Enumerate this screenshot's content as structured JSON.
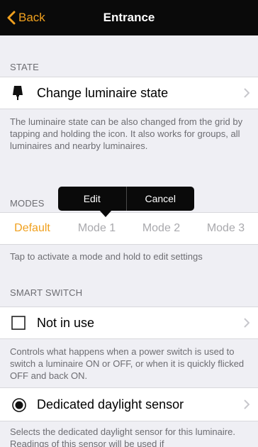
{
  "nav": {
    "back_label": "Back",
    "title": "Entrance"
  },
  "state": {
    "header": "STATE",
    "cell_label": "Change luminaire state",
    "footer": "The luminaire state can be also changed from the grid by tapping and holding the icon. It also works for groups, all luminaires and nearby luminaires."
  },
  "modes": {
    "header": "MODES",
    "tabs": [
      "Default",
      "Mode 1",
      "Mode 2",
      "Mode 3"
    ],
    "active_tab": "Default",
    "footer": "Tap to activate a mode and hold to edit settings"
  },
  "popup": {
    "edit_label": "Edit",
    "cancel_label": "Cancel"
  },
  "smart_switch": {
    "header": "SMART SWITCH",
    "cell_label": "Not in use",
    "footer": "Controls what happens when a power switch is used to switch a luminaire ON or OFF, or when it is quickly flicked OFF and back ON."
  },
  "daylight": {
    "cell_label": "Dedicated daylight sensor",
    "footer": "Selects the dedicated daylight sensor for this luminaire. Readings of this sensor will be used if"
  },
  "colors": {
    "accent": "#f0a01e",
    "navbar": "#0a0a0a",
    "background": "#efeff4",
    "secondary_text": "#6d6d72"
  },
  "icons": {
    "back": "chevron-left-icon",
    "state": "table-lamp-icon",
    "smart_switch": "empty-checkbox-icon",
    "daylight": "radio-selected-icon",
    "disclosure": "chevron-right-icon"
  }
}
